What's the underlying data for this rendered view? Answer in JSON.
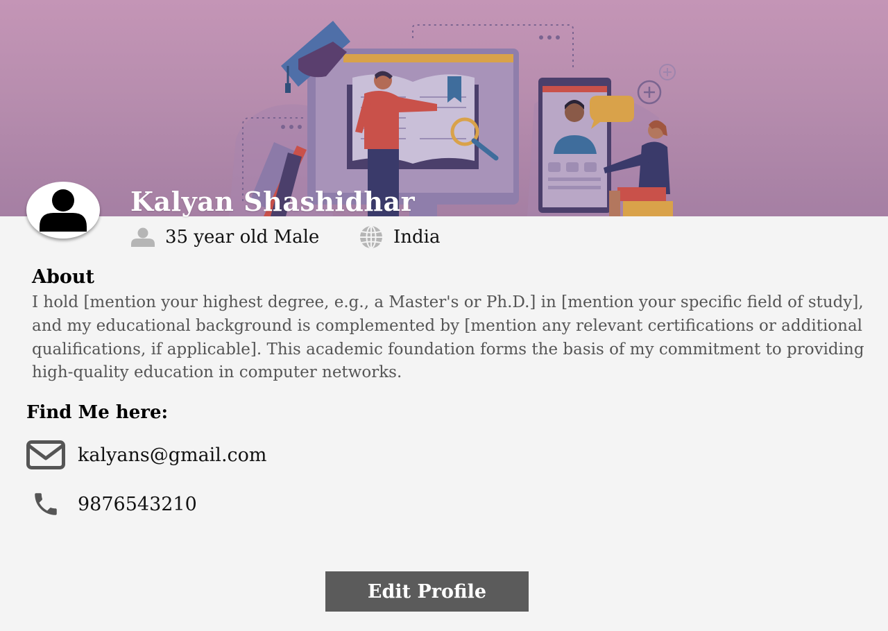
{
  "profile": {
    "name": "Kalyan Shashidhar",
    "age_gender": "35 year old Male",
    "country": "India"
  },
  "about": {
    "heading": "About",
    "text": "I hold [mention your highest degree, e.g., a Master's or Ph.D.] in [mention your specific field of study], and my educational background is complemented by [mention any relevant certifications or additional qualifications, if applicable]. This academic foundation forms the basis of my commitment to providing high-quality education in computer networks."
  },
  "contact": {
    "heading": "Find Me here:",
    "email": "kalyans@gmail.com",
    "phone": "9876543210"
  },
  "actions": {
    "edit_profile": "Edit Profile"
  },
  "icons": {
    "avatar": "user-silhouette-icon",
    "age": "person-icon",
    "country": "globe-icon",
    "email": "envelope-icon",
    "phone": "phone-icon"
  },
  "colors": {
    "banner": "#c495b6",
    "page_background": "#f4f4f4",
    "button": "#5b5b5b",
    "icon_gray": "#b5b5b5",
    "icon_dark": "#555555"
  }
}
